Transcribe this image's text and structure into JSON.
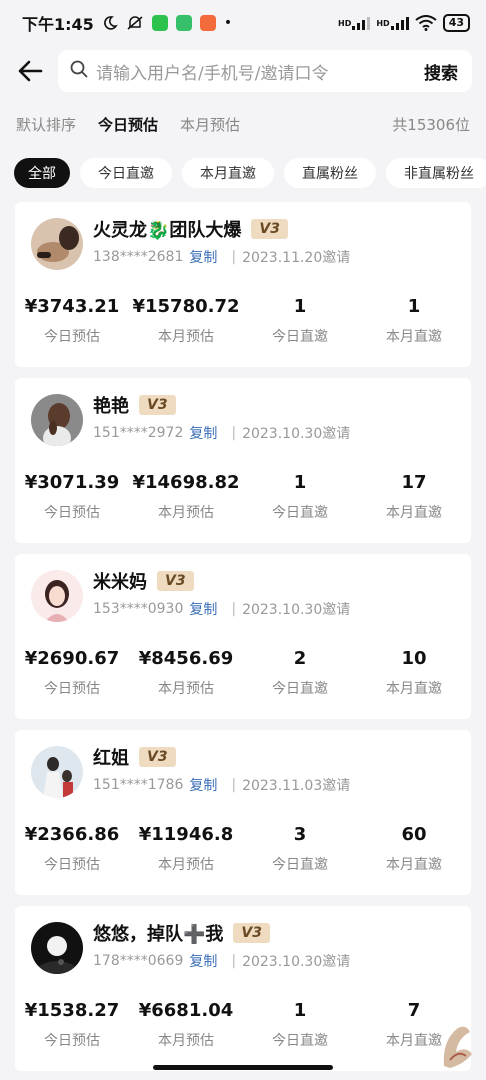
{
  "status_bar": {
    "time": "下午1:45",
    "battery": "43",
    "icons": [
      "moon-icon",
      "mute-icon",
      "wechat-icon",
      "app-icon",
      "app-icon-2",
      "signal-hd-icon",
      "signal-hd-icon-2",
      "wifi-icon",
      "battery-icon"
    ],
    "signal_label_1": "HD",
    "signal_label_2": "HD"
  },
  "search": {
    "placeholder": "请输入用户名/手机号/邀请口令",
    "button_label": "搜索"
  },
  "sort": {
    "options": [
      "默认排序",
      "今日预估",
      "本月预估"
    ],
    "active_index": 1,
    "total": "共15306位"
  },
  "filters": {
    "chips": [
      "全部",
      "今日直邀",
      "本月直邀",
      "直属粉丝",
      "非直属粉丝"
    ],
    "active_index": 0
  },
  "colors": {
    "accent_link": "#3b6fb6",
    "badge_bg": "#efdcc0",
    "active_chip": "#111111"
  },
  "members": [
    {
      "name": "火灵龙🐉团队大爆",
      "level": "V3",
      "phone": "138****2681",
      "copy_label": "复制",
      "invite_date": "2023.11.20邀请",
      "stats": [
        {
          "value": "¥3743.21",
          "label": "今日预估"
        },
        {
          "value": "¥15780.72",
          "label": "本月预估"
        },
        {
          "value": "1",
          "label": "今日直邀"
        },
        {
          "value": "1",
          "label": "本月直邀"
        }
      ]
    },
    {
      "name": "艳艳",
      "level": "V3",
      "phone": "151****2972",
      "copy_label": "复制",
      "invite_date": "2023.10.30邀请",
      "stats": [
        {
          "value": "¥3071.39",
          "label": "今日预估"
        },
        {
          "value": "¥14698.82",
          "label": "本月预估"
        },
        {
          "value": "1",
          "label": "今日直邀"
        },
        {
          "value": "17",
          "label": "本月直邀"
        }
      ]
    },
    {
      "name": "米米妈",
      "level": "V3",
      "phone": "153****0930",
      "copy_label": "复制",
      "invite_date": "2023.10.30邀请",
      "stats": [
        {
          "value": "¥2690.67",
          "label": "今日预估"
        },
        {
          "value": "¥8456.69",
          "label": "本月预估"
        },
        {
          "value": "2",
          "label": "今日直邀"
        },
        {
          "value": "10",
          "label": "本月直邀"
        }
      ]
    },
    {
      "name": "红姐",
      "level": "V3",
      "phone": "151****1786",
      "copy_label": "复制",
      "invite_date": "2023.11.03邀请",
      "stats": [
        {
          "value": "¥2366.86",
          "label": "今日预估"
        },
        {
          "value": "¥11946.8",
          "label": "本月预估"
        },
        {
          "value": "3",
          "label": "今日直邀"
        },
        {
          "value": "60",
          "label": "本月直邀"
        }
      ]
    },
    {
      "name": "悠悠，掉队➕我",
      "level": "V3",
      "phone": "178****0669",
      "copy_label": "复制",
      "invite_date": "2023.10.30邀请",
      "stats": [
        {
          "value": "¥1538.27",
          "label": "今日预估"
        },
        {
          "value": "¥6681.04",
          "label": "本月预估"
        },
        {
          "value": "1",
          "label": "今日直邀"
        },
        {
          "value": "7",
          "label": "本月直邀"
        }
      ]
    }
  ]
}
